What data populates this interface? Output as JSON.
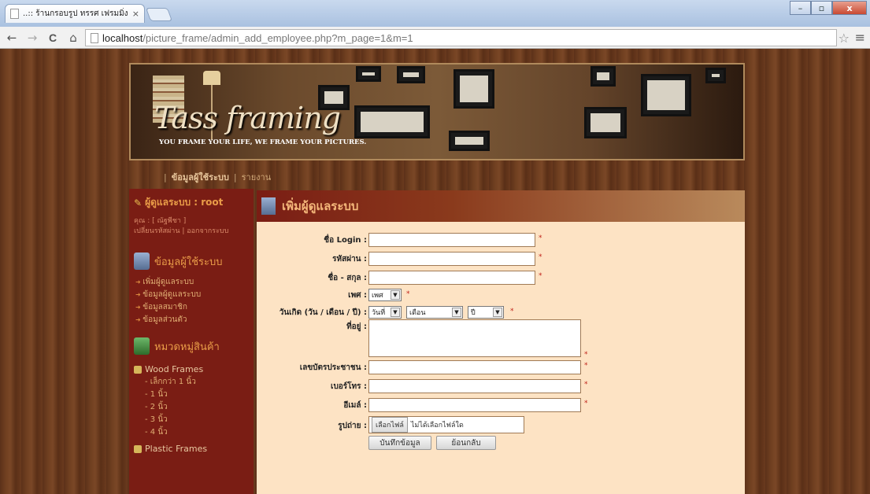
{
  "browser": {
    "tab_title": "..:: ร้านกรอบรูป ทรรศ เฟรมมิ่ง",
    "tab_close": "×",
    "url_host": "localhost",
    "url_path": "/picture_frame/admin_add_employee.php?m_page=1&m=1",
    "back": "←",
    "forward": "→",
    "reload": "C",
    "home": "⌂",
    "star": "☆",
    "menu": "≡",
    "win_min": "–",
    "win_max": "▫",
    "win_close": "x"
  },
  "banner": {
    "logo": "Tass framing",
    "tagline": "YOU FRAME YOUR LIFE, WE FRAME YOUR PICTURES."
  },
  "mainnav": {
    "item1": "ข้อมูลผู้ใช้ระบบ",
    "item2": "รายงาน"
  },
  "sidebar": {
    "admin_label": "ผู้ดูแลระบบ : root",
    "user_line": "คุณ : [ ณัฐพีชา ]",
    "links_line": "เปลี่ยนรหัสผ่าน | ออกจากระบบ",
    "section1_title": "ข้อมูลผู้ใช้ระบบ",
    "section1_items": [
      "เพิ่มผู้ดูแลระบบ",
      "ข้อมูลผู้ดูแลระบบ",
      "ข้อมูลสมาชิก",
      "ข้อมูลส่วนตัว"
    ],
    "section2_title": "หมวดหมู่สินค้า",
    "group1": "Wood Frames",
    "group1_items": [
      "- เล็กกว่า 1 นิ้ว",
      "- 1 นิ้ว",
      "- 2 นิ้ว",
      "- 3 นิ้ว",
      "- 4 นิ้ว"
    ],
    "group2": "Plastic Frames"
  },
  "content": {
    "title": "เพิ่มผู้ดูแลระบบ",
    "form": {
      "login_label": "ชื่อ Login :",
      "password_label": "รหัสผ่าน :",
      "name_label": "ชื่อ - สกุล :",
      "gender_label": "เพศ :",
      "gender_value": "เพศ",
      "birth_label": "วันเกิด (วัน / เดือน / ปี) :",
      "day_value": "วันที่",
      "month_value": "เดือน",
      "year_value": "ปี",
      "address_label": "ที่อยู่ :",
      "idcard_label": "เลขบัตรประชาชน :",
      "phone_label": "เบอร์โทร :",
      "email_label": "อีเมล์ :",
      "photo_label": "รูปถ่าย :",
      "file_button": "เลือกไฟล์",
      "file_status": "ไม่ได้เลือกไฟล์ใด",
      "required_mark": "*"
    },
    "save_button": "บันทึกข้อมูล",
    "back_button": "ย้อนกลับ"
  }
}
